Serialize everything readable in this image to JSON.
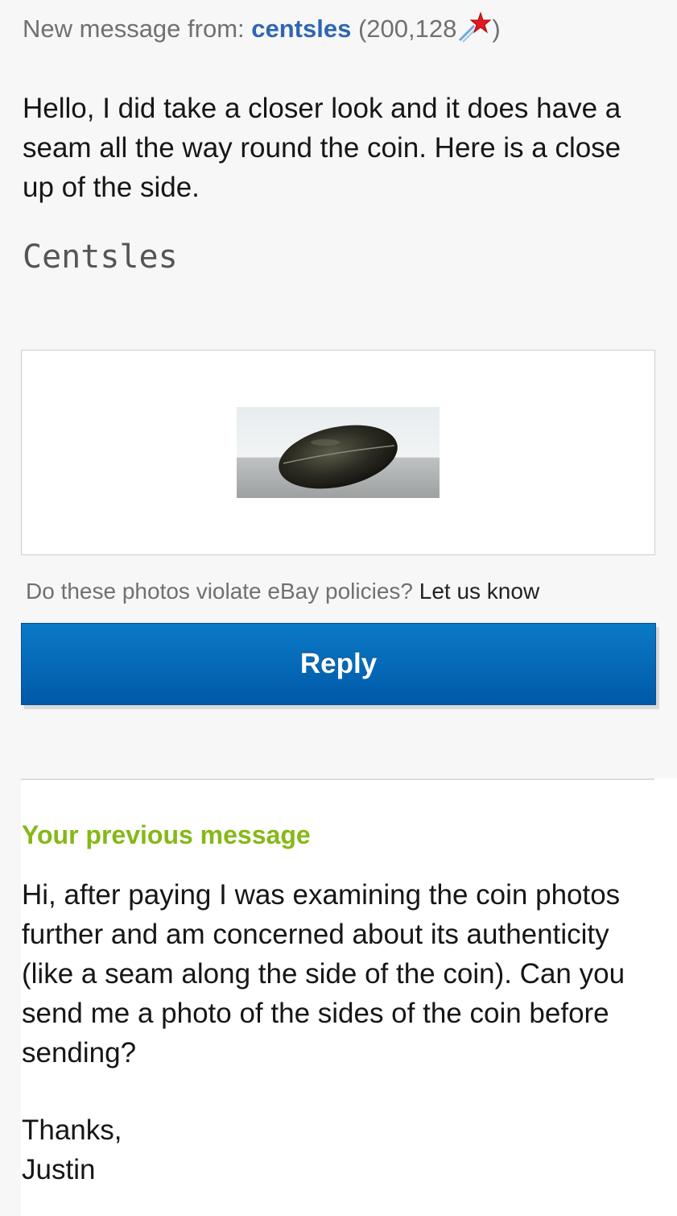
{
  "header": {
    "prefix": "New message from:",
    "username": "centsles",
    "feedback_open": "(",
    "feedback_score": "200,128",
    "feedback_close": ")",
    "star_icon": "shooting-star-icon"
  },
  "message": {
    "body": "Hello, I did take a closer look and it does have a seam all the way round the coin. Here is a close up of the side.",
    "signature": "Centsles"
  },
  "policy": {
    "question": "Do these photos violate eBay policies?",
    "link": "Let us know"
  },
  "reply_button": {
    "label": "Reply"
  },
  "previous": {
    "title": "Your previous message",
    "body": "Hi, after paying I was examining the coin photos further and am concerned about its authenticity (like a seam along the side of the coin). Can you send me a photo of the sides of the coin before sending?",
    "closing": "Thanks,",
    "name": "Justin"
  },
  "colors": {
    "username": "#2f66b3",
    "reply_button": "#0068b8",
    "previous_title": "#86b817",
    "star": "#e01b24"
  }
}
